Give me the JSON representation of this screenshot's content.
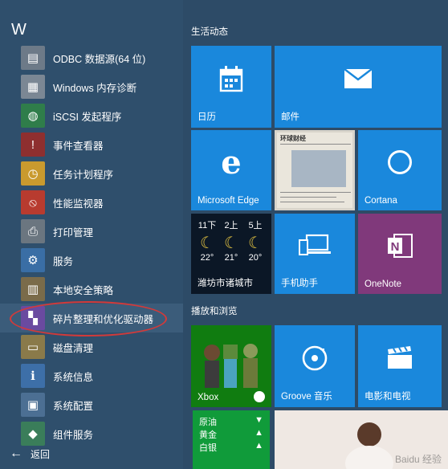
{
  "left": {
    "letter": "W",
    "apps": [
      {
        "label": "ODBC 数据源(64 位)",
        "icon": "odbc-icon",
        "glyph": "▤",
        "color": "#6d7a88"
      },
      {
        "label": "Windows 内存诊断",
        "icon": "memory-icon",
        "glyph": "▦",
        "color": "#7b8794"
      },
      {
        "label": "iSCSI 发起程序",
        "icon": "iscsi-globe-icon",
        "glyph": "◍",
        "color": "#2f7d4a"
      },
      {
        "label": "事件查看器",
        "icon": "event-viewer-icon",
        "glyph": "!",
        "color": "#8e2f2f"
      },
      {
        "label": "任务计划程序",
        "icon": "clock-icon",
        "glyph": "◷",
        "color": "#c99a2e"
      },
      {
        "label": "性能监视器",
        "icon": "performance-icon",
        "glyph": "⦸",
        "color": "#b83b2f"
      },
      {
        "label": "打印管理",
        "icon": "printer-icon",
        "glyph": "⎙",
        "color": "#6b7680"
      },
      {
        "label": "服务",
        "icon": "gears-icon",
        "glyph": "⚙",
        "color": "#3a6ea5"
      },
      {
        "label": "本地安全策略",
        "icon": "security-policy-icon",
        "glyph": "▥",
        "color": "#7a6b4a"
      },
      {
        "label": "碎片整理和优化驱动器",
        "icon": "defrag-icon",
        "glyph": "▚",
        "color": "#6a4aa0"
      },
      {
        "label": "磁盘清理",
        "icon": "disk-cleanup-icon",
        "glyph": "▭",
        "color": "#8a7a4a"
      },
      {
        "label": "系统信息",
        "icon": "system-info-icon",
        "glyph": "ℹ",
        "color": "#3d6fa8"
      },
      {
        "label": "系统配置",
        "icon": "system-config-icon",
        "glyph": "▣",
        "color": "#4c6f93"
      },
      {
        "label": "组件服务",
        "icon": "component-services-icon",
        "glyph": "◆",
        "color": "#3a7d5a"
      }
    ],
    "back_label": "返回"
  },
  "sections": {
    "life": "生活动态",
    "play": "播放和浏览"
  },
  "tiles": {
    "calendar": {
      "label": "日历",
      "color": "#1a88dc"
    },
    "mail": {
      "label": "邮件",
      "color": "#1a88dc"
    },
    "news": {
      "header": "环球财经"
    },
    "edge": {
      "label": "Microsoft Edge",
      "color": "#1a88dc"
    },
    "cortana": {
      "label": "Cortana",
      "color": "#1a88dc"
    },
    "weather": {
      "label": "潍坊市诸城市",
      "days": [
        {
          "day": "11下",
          "temp": "22°"
        },
        {
          "day": "2上",
          "temp": "21°"
        },
        {
          "day": "5上",
          "temp": "20°"
        }
      ]
    },
    "phone": {
      "label": "手机助手",
      "color": "#1a88dc"
    },
    "onenote": {
      "label": "OneNote",
      "color": "#80397b"
    },
    "xbox": {
      "label": "Xbox",
      "color": "#107c10"
    },
    "groove": {
      "label": "Groove 音乐",
      "color": "#1a88dc"
    },
    "movies": {
      "label": "电影和电视",
      "color": "#1a88dc"
    },
    "stocks": {
      "rows": [
        {
          "name": "原油",
          "arrow": "▼"
        },
        {
          "name": "黄金",
          "arrow": "▲"
        },
        {
          "name": "白银",
          "arrow": "▲"
        }
      ]
    },
    "photo": {
      "watermark": "Baidu 经验"
    }
  }
}
